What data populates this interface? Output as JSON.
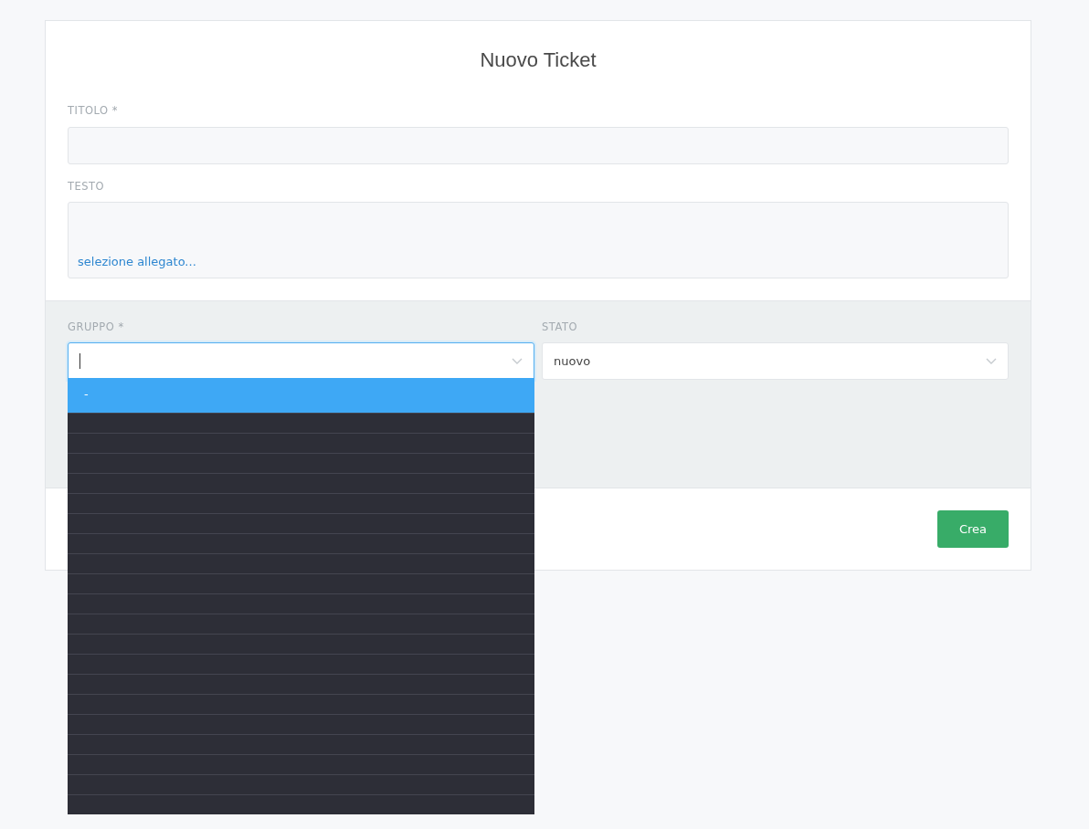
{
  "title": "Nuovo Ticket",
  "fields": [
    {
      "label": "TITOLO *",
      "kind": "input"
    },
    {
      "label": "TESTO",
      "kind": "textarea",
      "link": "selezione allegato..."
    }
  ],
  "selects": [
    {
      "label": "GRUPPO *",
      "focused": true,
      "open": true
    },
    {
      "label": "STATO",
      "value": "nuovo",
      "focused": false,
      "open": false
    }
  ],
  "dropdown_options": [
    {
      "kind": "text",
      "label": "-",
      "selected": true
    },
    {
      "kind": "blank",
      "selected": false
    },
    {
      "kind": "blank",
      "selected": false
    },
    {
      "kind": "blank",
      "selected": false
    },
    {
      "kind": "blank",
      "selected": false
    },
    {
      "kind": "blank",
      "selected": false
    },
    {
      "kind": "blank",
      "selected": false
    },
    {
      "kind": "blank",
      "selected": false
    },
    {
      "kind": "blank",
      "selected": false
    },
    {
      "kind": "blank",
      "selected": false
    },
    {
      "kind": "blank",
      "selected": false
    },
    {
      "kind": "blank",
      "selected": false
    },
    {
      "kind": "blank",
      "selected": false
    },
    {
      "kind": "blank",
      "selected": false
    },
    {
      "kind": "blank",
      "selected": false
    },
    {
      "kind": "blank",
      "selected": false
    },
    {
      "kind": "blank",
      "selected": false
    },
    {
      "kind": "blank",
      "selected": false
    },
    {
      "kind": "blank",
      "selected": false
    },
    {
      "kind": "blank",
      "selected": false
    },
    {
      "kind": "blank",
      "selected": false
    }
  ],
  "submit_button": "Crea"
}
